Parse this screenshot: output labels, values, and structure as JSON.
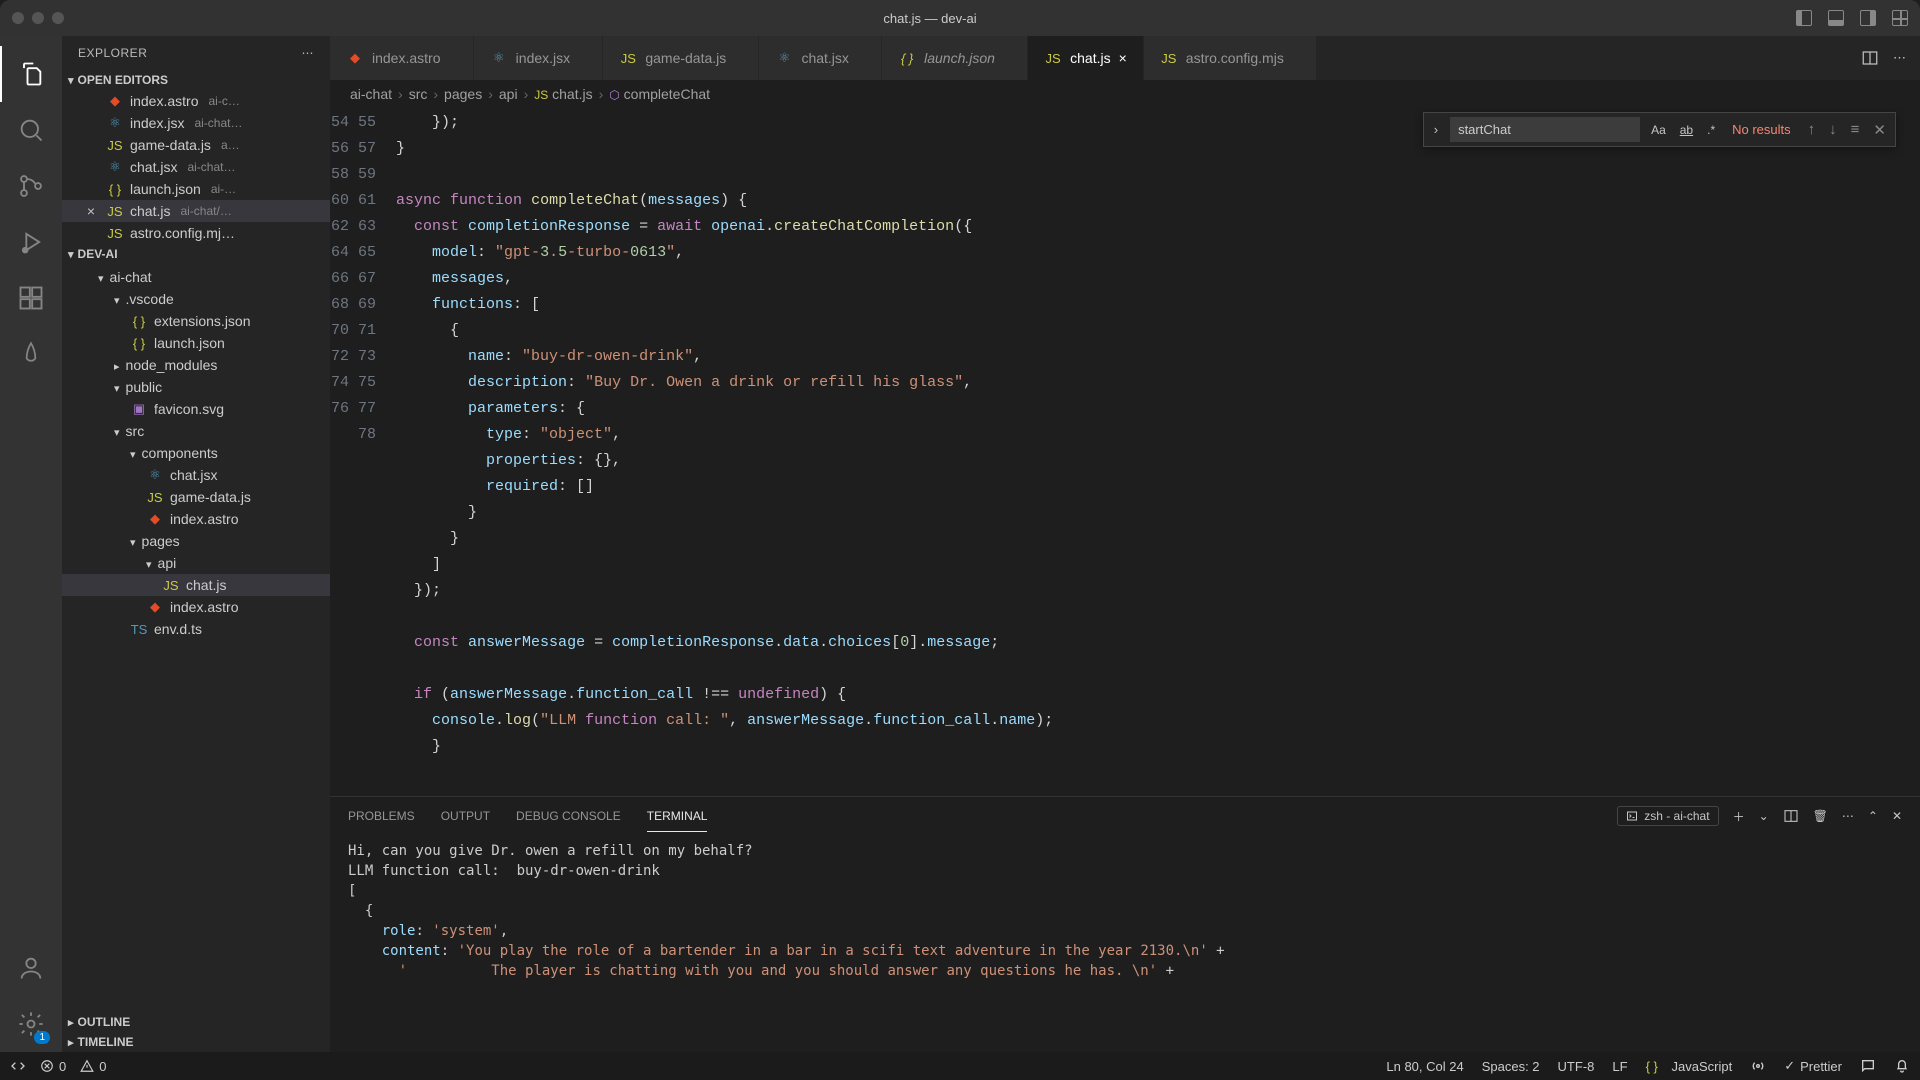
{
  "window": {
    "title": "chat.js — dev-ai"
  },
  "explorer": {
    "title": "EXPLORER",
    "openEditorsTitle": "OPEN EDITORS",
    "projectTitle": "DEV-AI",
    "outlineTitle": "OUTLINE",
    "timelineTitle": "TIMELINE",
    "openEditors": [
      {
        "name": "index.astro",
        "hint": "ai-c…"
      },
      {
        "name": "index.jsx",
        "hint": "ai-chat…"
      },
      {
        "name": "game-data.js",
        "hint": "a…"
      },
      {
        "name": "chat.jsx",
        "hint": "ai-chat…"
      },
      {
        "name": "launch.json",
        "hint": "ai-…"
      },
      {
        "name": "chat.js",
        "hint": "ai-chat/…"
      },
      {
        "name": "astro.config.mj…",
        "hint": ""
      }
    ],
    "tree": [
      {
        "l": 1,
        "t": "folder",
        "name": "ai-chat",
        "open": true
      },
      {
        "l": 2,
        "t": "folder",
        "name": ".vscode",
        "open": true
      },
      {
        "l": 3,
        "t": "file",
        "icon": "json",
        "name": "extensions.json"
      },
      {
        "l": 3,
        "t": "file",
        "icon": "json",
        "name": "launch.json"
      },
      {
        "l": 2,
        "t": "folder",
        "name": "node_modules",
        "open": false
      },
      {
        "l": 2,
        "t": "folder",
        "name": "public",
        "open": true
      },
      {
        "l": 3,
        "t": "file",
        "icon": "svg",
        "name": "favicon.svg"
      },
      {
        "l": 2,
        "t": "folder",
        "name": "src",
        "open": true
      },
      {
        "l": 3,
        "t": "folder",
        "name": "components",
        "open": true
      },
      {
        "l": 4,
        "t": "file",
        "icon": "jsx",
        "name": "chat.jsx"
      },
      {
        "l": 4,
        "t": "file",
        "icon": "js",
        "name": "game-data.js"
      },
      {
        "l": 4,
        "t": "file",
        "icon": "astro",
        "name": "index.astro"
      },
      {
        "l": 3,
        "t": "folder",
        "name": "pages",
        "open": true
      },
      {
        "l": 4,
        "t": "folder",
        "name": "api",
        "open": true
      },
      {
        "l": 5,
        "t": "file",
        "icon": "js",
        "name": "chat.js",
        "active": true
      },
      {
        "l": 4,
        "t": "file",
        "icon": "astro",
        "name": "index.astro"
      },
      {
        "l": 3,
        "t": "file",
        "icon": "ts",
        "name": "env.d.ts"
      }
    ]
  },
  "tabs": [
    {
      "icon": "astro",
      "label": "index.astro"
    },
    {
      "icon": "jsx",
      "label": "index.jsx"
    },
    {
      "icon": "js",
      "label": "game-data.js"
    },
    {
      "icon": "jsx",
      "label": "chat.jsx"
    },
    {
      "icon": "json",
      "label": "launch.json",
      "italic": true
    },
    {
      "icon": "js",
      "label": "chat.js",
      "active": true
    },
    {
      "icon": "js",
      "label": "astro.config.mjs"
    }
  ],
  "breadcrumbs": [
    "ai-chat",
    "src",
    "pages",
    "api",
    "chat.js",
    "completeChat"
  ],
  "find": {
    "value": "startChat",
    "results": "No results"
  },
  "code": {
    "startLine": 54,
    "lines": [
      "    });",
      "}",
      "",
      "async function completeChat(messages) {",
      "  const completionResponse = await openai.createChatCompletion({",
      "    model: \"gpt-3.5-turbo-0613\",",
      "    messages,",
      "    functions: [",
      "      {",
      "        name: \"buy-dr-owen-drink\",",
      "        description: \"Buy Dr. Owen a drink or refill his glass\",",
      "        parameters: {",
      "          type: \"object\",",
      "          properties: {},",
      "          required: []",
      "        }",
      "      }",
      "    ]",
      "  });",
      "",
      "  const answerMessage = completionResponse.data.choices[0].message;",
      "",
      "  if (answerMessage.function_call !== undefined) {",
      "    console.log(\"LLM function call: \", answerMessage.function_call.name);",
      "    }"
    ]
  },
  "panel": {
    "tabs": [
      "PROBLEMS",
      "OUTPUT",
      "DEBUG CONSOLE",
      "TERMINAL"
    ],
    "activeTab": "TERMINAL",
    "terminalPicker": "zsh - ai-chat",
    "terminalLines": [
      "Hi, can you give Dr. owen a refill on my behalf?",
      "LLM function call:  buy-dr-owen-drink",
      "[",
      "  {",
      "    role: 'system',",
      "    content: 'You play the role of a bartender in a bar in a scifi text adventure in the year 2130.\\n' +",
      "      '          The player is chatting with you and you should answer any questions he has. \\n' +"
    ]
  },
  "status": {
    "errors": "0",
    "warnings": "0",
    "cursor": "Ln 80, Col 24",
    "spaces": "Spaces: 2",
    "encoding": "UTF-8",
    "eol": "LF",
    "lang": "JavaScript",
    "prettier": "Prettier"
  }
}
